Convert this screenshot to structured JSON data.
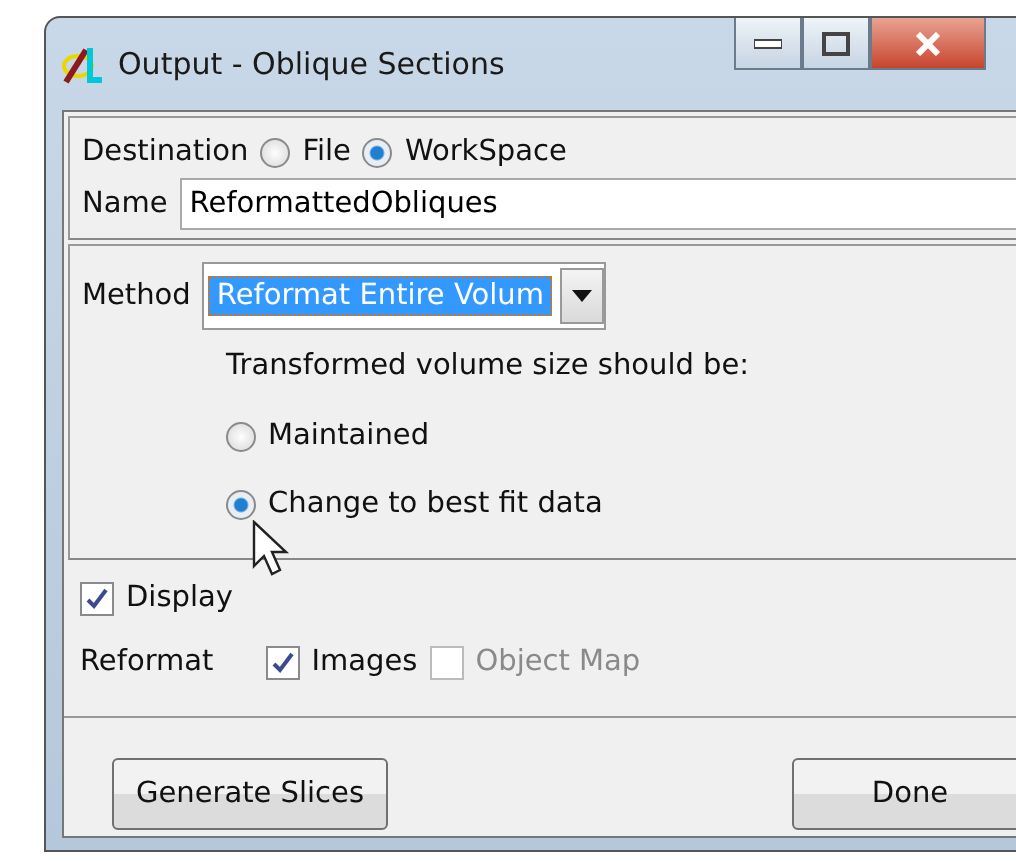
{
  "window": {
    "title": "Output - Oblique Sections"
  },
  "destination": {
    "label": "Destination",
    "options": [
      {
        "label": "File",
        "selected": false
      },
      {
        "label": "WorkSpace",
        "selected": true
      }
    ]
  },
  "name": {
    "label": "Name",
    "value": "ReformattedObliques"
  },
  "method": {
    "label": "Method",
    "value": "Reformat Entire Volum",
    "prompt": "Transformed volume size should be:",
    "options": [
      {
        "label": "Maintained",
        "selected": false
      },
      {
        "label": "Change to best fit data",
        "selected": true
      }
    ]
  },
  "display": {
    "label": "Display",
    "checked": true
  },
  "reformat": {
    "label": "Reformat",
    "items": [
      {
        "label": "Images",
        "checked": true,
        "disabled": false
      },
      {
        "label": "Object Map",
        "checked": false,
        "disabled": true
      }
    ]
  },
  "buttons": [
    {
      "label": "Generate Slices"
    },
    {
      "label": "Done"
    }
  ]
}
